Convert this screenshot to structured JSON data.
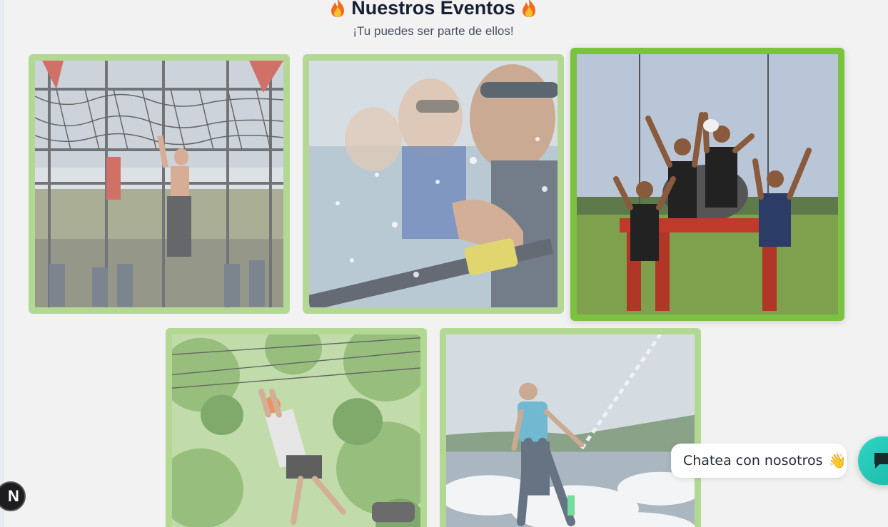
{
  "header": {
    "title": "Nuestros Eventos",
    "subtitle": "¡Tu puedes ser parte de ellos!",
    "title_icon": "fire-icon"
  },
  "events": [
    {
      "name": "event-card-obstacle-course",
      "subject": "obstacle net climb",
      "active": false
    },
    {
      "name": "event-card-rowing",
      "subject": "rowing crew",
      "active": false
    },
    {
      "name": "event-card-team-celebration",
      "subject": "team celebration",
      "active": true
    },
    {
      "name": "event-card-zipline",
      "subject": "zipline in trees",
      "active": false
    },
    {
      "name": "event-card-wakeboard",
      "subject": "wakeboarding",
      "active": false
    }
  ],
  "chat": {
    "label": "Chatea con nosotros",
    "emoji": "👋",
    "button_icon": "chat-bubble-icon"
  },
  "dev_badge": {
    "label": "N",
    "icon": "nextjs-badge-icon"
  },
  "colors": {
    "card_border": "#b3d894",
    "card_border_active": "#7bc241",
    "chat_fab": "#2fd6c4",
    "title": "#172033"
  }
}
